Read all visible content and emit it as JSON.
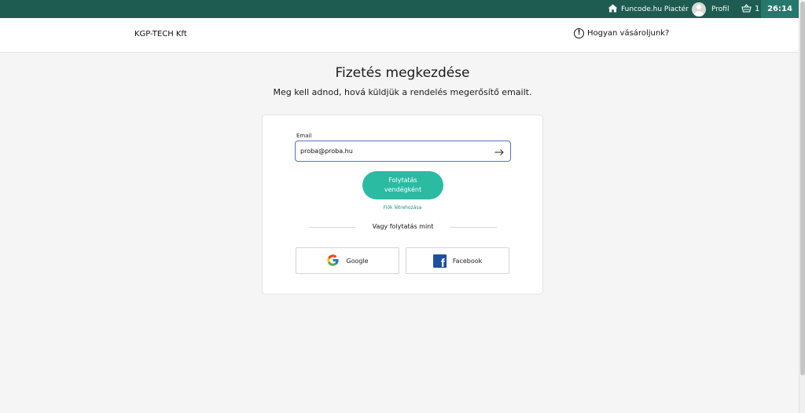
{
  "topbar": {
    "marketplace_label": "Funcode.hu Piactér",
    "marketplace_icon": "home-icon",
    "profile_label": "Profil",
    "cart_count": "1",
    "timer": "26:14",
    "colors": {
      "bar": "#1e5c52",
      "timer_bg": "#27786c"
    }
  },
  "header": {
    "company": "KGP-TECH Kft",
    "howto_label": "Hogyan vásároljunk?"
  },
  "main": {
    "title": "Fizetés megkezdése",
    "subtitle": "Meg kell adnod, hová küldjük a rendelés megerősítő emailt."
  },
  "form": {
    "email_label": "Email",
    "email_value": "proba@proba.hu",
    "guest_button_line1": "Folytatás",
    "guest_button_line2": "vendégként",
    "create_account_link": "Fiók létrehozása",
    "divider_text": "Vagy folytatás mint",
    "google_label": "Google",
    "facebook_label": "Facebook",
    "accent_color": "#2bbba3"
  }
}
